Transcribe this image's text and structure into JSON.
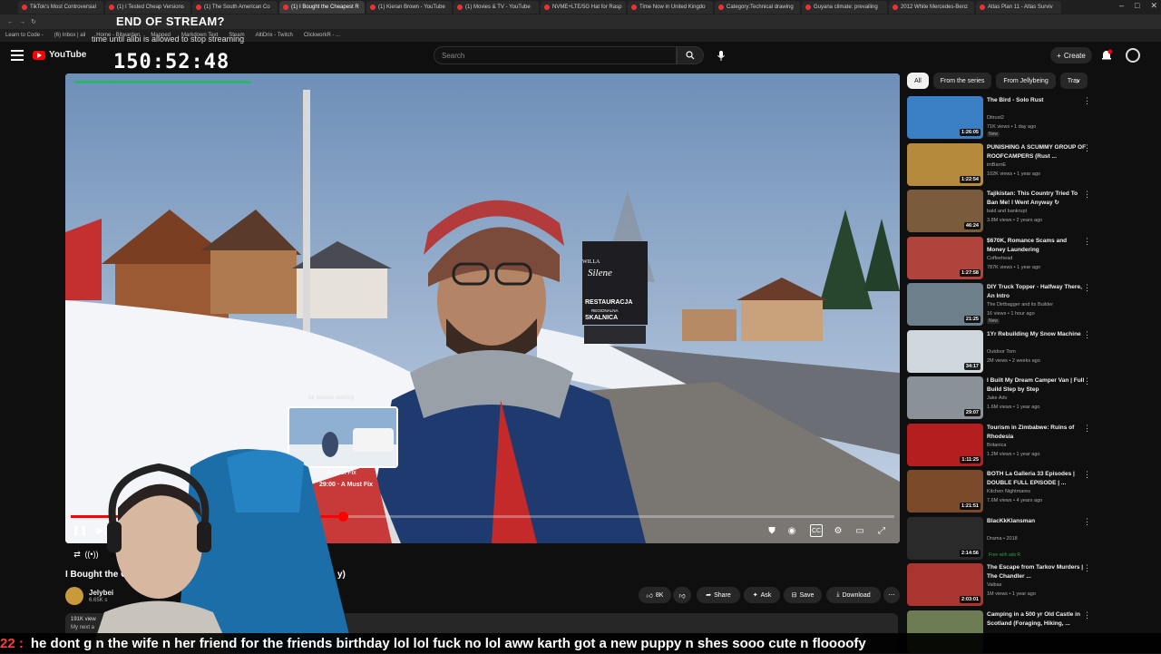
{
  "browser": {
    "tabs": [
      "TikTok's Most Controversial",
      "(1) I Tested Cheap Versions",
      "(1) The South American Co",
      "(1) I Bought the Cheapest R",
      "(1) Kieran Brown - YouTube",
      "(1) Movies & TV - YouTube",
      "NVME+LTE/5G Hat for Rasp",
      "Time Now in United Kingdo",
      "Category:Technical drawing",
      "Guyana climate: prevailing",
      "2012 White Mercedes-Benz",
      "Atlas Plan 11 - Atlas Surviv"
    ],
    "active_tab_index": 3,
    "bookmarks": [
      "Learn to Code -",
      "(6) Inbox | ail",
      "Home - Bitwarden",
      "Mapped",
      "Markdown Text",
      "Steam",
      "AltiDrix - Twitch",
      "ClickworkR - ..."
    ]
  },
  "overlay": {
    "title": "END OF STREAM?",
    "subtitle": "time until alibi is allowed to stop streaming",
    "timer": "150:52:48"
  },
  "header": {
    "logo": "YouTube",
    "search_placeholder": "Search",
    "create_label": "Create"
  },
  "player": {
    "seek_hint": "for precise seeking",
    "preview_title": "A Must Fix",
    "preview_time": "29:00 · A Must Fix",
    "progress": 0.33,
    "sign_top": "WILLA",
    "sign_name": "Silene",
    "sign_restaurant": "RESTAURACJA",
    "sign_sub": "REGIONALNA",
    "sign_big": "SKALNICA"
  },
  "video": {
    "title": "I Bought the C",
    "title_tail": "y)",
    "channel": "Jelybei",
    "subs": "6.65K s",
    "views": "191K view",
    "desc_line2": "My next a",
    "like_count": "8K",
    "actions": {
      "share": "Share",
      "ask": "Ask",
      "save": "Save",
      "download": "Download"
    }
  },
  "chips": [
    "All",
    "From the series",
    "From Jellybeing",
    "Trav"
  ],
  "recommendations": [
    {
      "title": "The Bird - Solo Rust",
      "channel": "Ditrust2",
      "meta": "71K views • 1 day ago",
      "badge": "New",
      "duration": "1:26:05",
      "color": "#3a7fc4"
    },
    {
      "title": "PUNISHING A SCUMMY GROUP OF ROOFCAMPERS (Rust ...",
      "channel": "imBarnE",
      "meta": "102K views • 1 year ago",
      "badge": "",
      "duration": "1:22:54",
      "color": "#b58a3c"
    },
    {
      "title": "Tajikistan: This Country Tried To Ban Me! I Went Anyway ↻",
      "channel": "bald and bankrupt",
      "meta": "3.8M views • 2 years ago",
      "badge": "",
      "duration": "46:24",
      "color": "#7a5c3c"
    },
    {
      "title": "$670K, Romance Scams and Money Laundering",
      "channel": "Coffeehead",
      "meta": "787K views • 1 year ago",
      "badge": "",
      "duration": "1:27:58",
      "color": "#b0443a"
    },
    {
      "title": "DIY Truck Topper - Halfway There, An Intro",
      "channel": "The Dirtbagger and its Builder",
      "meta": "16 views • 1 hour ago",
      "badge": "New",
      "duration": "21:25",
      "color": "#6e7f8c"
    },
    {
      "title": "1Yr Rebuilding My Snow Machine",
      "channel": "Outdoor Tom",
      "meta": "2M views • 2 weeks ago",
      "badge": "",
      "duration": "34:17",
      "color": "#cfd6dc"
    },
    {
      "title": "I Built My Dream Camper Van | Full Build Step by Step",
      "channel": "Jake Adv",
      "meta": "1.6M views • 1 year ago",
      "badge": "",
      "duration": "29:07",
      "color": "#8b9198"
    },
    {
      "title": "Tourism in Zimbabwe: Ruins of Rhodesia",
      "channel": "Britanica",
      "meta": "1.2M views • 1 year ago",
      "badge": "",
      "duration": "1:11:25",
      "color": "#b51e1e"
    },
    {
      "title": "BOTH La Galleria 33 Episodes | DOUBLE FULL EPISODE | ...",
      "channel": "Kitchen Nightmares",
      "meta": "7.6M views • 4 years ago",
      "badge": "",
      "duration": "1:21:51",
      "color": "#7b4a2a"
    },
    {
      "title": "BlacKkKlansman",
      "channel": "Drama • 2018",
      "meta": "",
      "badge": "Free with ads  R",
      "duration": "2:14:56",
      "color": "#2a2a2a"
    },
    {
      "title": "The Escape from Tarkov Murders | The Chandler ...",
      "channel": "Vaibas",
      "meta": "1M views • 1 year ago",
      "badge": "",
      "duration": "2:03:01",
      "color": "#a8352e"
    },
    {
      "title": "Camping in a 500 yr Old Castle in Scotland (Foraging, Hiking, ...",
      "channel": "",
      "meta": "",
      "badge": "",
      "duration": "",
      "color": "#6d7c52"
    }
  ],
  "chat": {
    "prefix": "22 :",
    "message": "he dont g                                                    n the wife n her friend for the friends birthday lol lol fuck no lol aww karth got a new puppy n shes sooo cute n floooofy"
  },
  "colors": {
    "accent": "#ff0000",
    "bg": "#0f0f0f",
    "timer_bar": "#2db36b"
  }
}
